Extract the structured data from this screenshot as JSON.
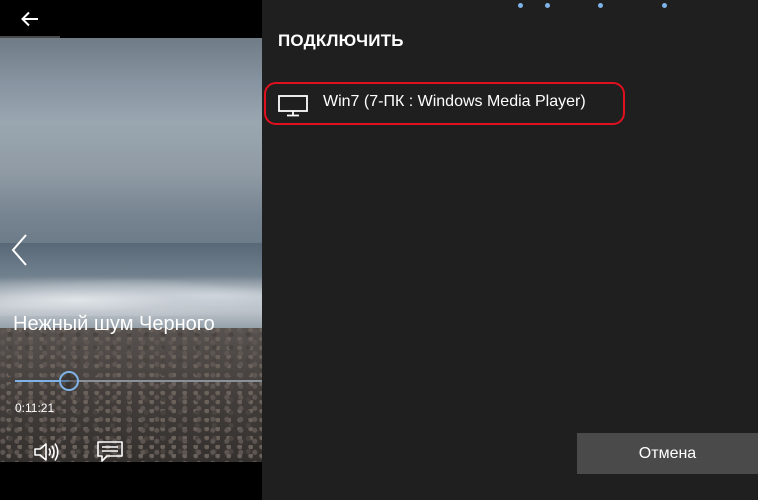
{
  "player": {
    "title": "Нежный шум Черного",
    "current_time": "0:11:21",
    "progress_fraction": 0.22
  },
  "flyout": {
    "header": "ПОДКЛЮЧИТЬ",
    "devices": [
      {
        "label": "Win7 (7-ПК : Windows Media Player)",
        "icon": "monitor-icon"
      }
    ],
    "cancel_label": "Отмена"
  },
  "colors": {
    "accent": "#7fb2e6",
    "highlight_border": "#e0101e",
    "flyout_bg": "#1f1f1f",
    "button_bg": "#4a4a4a"
  },
  "icons": [
    "back-arrow-icon",
    "chevron-left-icon",
    "volume-icon",
    "captions-icon",
    "monitor-icon",
    "loading-dots-icon"
  ]
}
